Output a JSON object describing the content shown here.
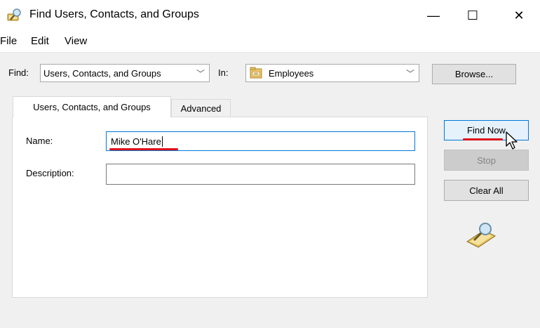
{
  "window": {
    "title": "Find Users, Contacts, and Groups",
    "minimize_glyph": "—",
    "maximize_glyph": "☐",
    "close_glyph": "✕"
  },
  "menu": {
    "items": [
      "File",
      "Edit",
      "View"
    ]
  },
  "find_row": {
    "find_label": "Find:",
    "find_value": "Users, Contacts, and Groups",
    "in_label": "In:",
    "in_value": "Employees",
    "browse_label": "Browse..."
  },
  "tabs": {
    "items": [
      "Users, Contacts, and Groups",
      "Advanced"
    ],
    "selected": "Users, Contacts, and Groups"
  },
  "form": {
    "name_label": "Name:",
    "name_value": "Mike O'Hare",
    "description_label": "Description:",
    "description_value": ""
  },
  "actions": {
    "find_now_label": "Find Now",
    "stop_label": "Stop",
    "clear_all_label": "Clear All"
  },
  "icons": {
    "app": "find-people-icon",
    "folder": "folder-icon",
    "search_animation": "magnifier-icon",
    "cursor": "mouse-pointer-icon"
  },
  "colors": {
    "focus_border": "#0078d7",
    "annotation_red": "#e0101a",
    "disabled_text": "#838383"
  }
}
